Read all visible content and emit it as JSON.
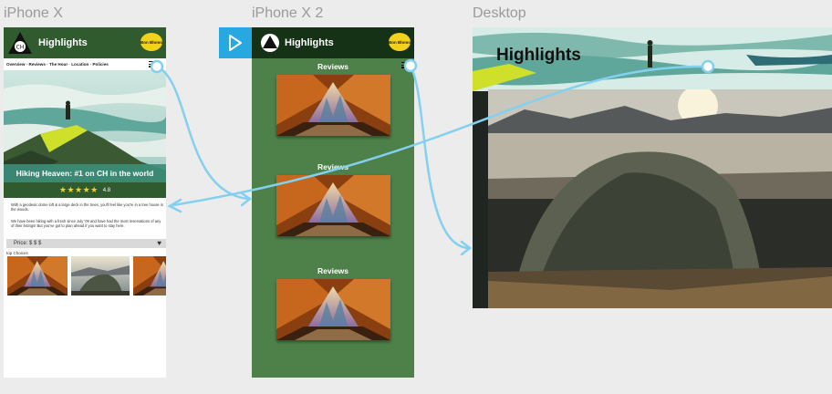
{
  "artboards": {
    "iphone_x": {
      "label": "iPhone X",
      "header": {
        "title": "Highlights",
        "badge": "Bon Blomo"
      },
      "nav": "Overview · Reviews · The Hour · Location · Policies",
      "hero_banner": "Hiking Heaven: #1 on CH in the world",
      "rating": {
        "stars": "★★★★★",
        "value": "4.8"
      },
      "paragraph_1": "With a geodesic dome loft & a large deck in the trees, you'll feel like you're in a tree house in the woods.",
      "paragraph_2": "We have been hiking with a fresh since July '09 and have had the most reservations of any of their listings! But you've got to plan ahead if you want to stay here.",
      "price": "Price: $ $ $",
      "top_choices": "top Choices"
    },
    "iphone_x2": {
      "label": "iPhone X 2",
      "header": {
        "title": "Highlights",
        "badge": "Bon Blomo"
      },
      "reviews": [
        "Reviews",
        "Reviews",
        "Reviews"
      ]
    },
    "desktop": {
      "label": "Desktop",
      "title": "Highlights"
    }
  },
  "colors": {
    "header_green": "#2f5b2f",
    "dark_green": "#163216",
    "panel_green": "#4e8049",
    "connector_blue": "#7fd0f2",
    "play_blue": "#27a8e0",
    "badge_yellow": "#f2d21b",
    "star_yellow": "#f7d21c"
  },
  "icons": {
    "play": "play-icon",
    "menu": "hamburger-icon",
    "heart": "heart-icon",
    "logo": "mountain-logo-icon"
  }
}
